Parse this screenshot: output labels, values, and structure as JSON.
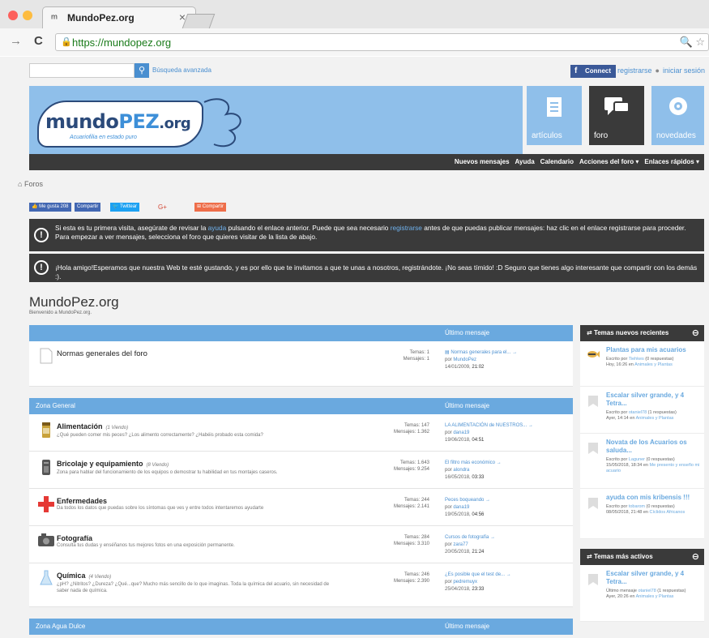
{
  "browser": {
    "tab_title": "MundoPez.org",
    "tab_close": "×",
    "url": "https://mundopez.org",
    "url_icons": "🔍 ☆"
  },
  "header": {
    "adv_search": "Búsqueda avanzada",
    "connect": "Connect",
    "register": "registrarse",
    "login": "iniciar sesión"
  },
  "logo": {
    "part1": "mundo",
    "part2": "PEZ",
    "part3": ".org",
    "tagline": "Acuariofilia en estado puro"
  },
  "nav_tiles": [
    {
      "label": "artículos",
      "icon": "document-icon"
    },
    {
      "label": "foro",
      "icon": "chat-icon"
    },
    {
      "label": "novedades",
      "icon": "eye-icon"
    }
  ],
  "nav_bar": [
    "Nuevos mensajes",
    "Ayuda",
    "Calendario",
    "Acciones del foro ▾",
    "Enlaces rápidos ▾"
  ],
  "breadcrumb": "Foros",
  "share": {
    "like": "Me gusta 208",
    "share_fb": "Compartir",
    "tweet": "Twittear",
    "gplus": "G+",
    "share": "Compartir"
  },
  "notices": {
    "n1_pre": "Si esta es tu primera visita, asegúrate de revisar la ",
    "n1_link1": "ayuda",
    "n1_mid": " pulsando el enlace anterior. Puede que sea necesario ",
    "n1_link2": "registrarse",
    "n1_post": " antes de que puedas publicar mensajes: haz clic en el enlace registrarse para proceder. Para empezar a ver mensajes, selecciona el foro que quieres visitar de la lista de abajo.",
    "n2": "¡Hola amigo!Esperamos que nuestra Web te esté gustando, y es por ello que te invitamos a que te unas a nosotros, registrándote. ¡No seas tímido! :D Seguro que tienes algo interesante que compartir con los demás :)."
  },
  "forum": {
    "title": "MundoPez.org",
    "subtitle": "Bienvenido a MundoPez.org.",
    "last_msg_header": "Último mensaje",
    "section_general": "Zona General",
    "section_agua": "Zona Agua Dulce",
    "rules": {
      "name": "Normas generales del foro",
      "stats1": "Temas: 1",
      "stats2": "Mensajes: 1",
      "last_title": "Normas generales para el...",
      "por": "por",
      "author": "MundoPez",
      "date": "14/01/2009,",
      "time": "21:02"
    },
    "rows": [
      {
        "name": "Alimentación",
        "view": "(1 Viendo)",
        "desc": "¿Qué pueden comer mis peces? ¿Los alimento correctamente? ¿Habéis probado esta comida?",
        "stats1": "Temas: 147",
        "stats2": "Mensajes: 1.362",
        "last_title": "LA ALIMENTACIÓN de NUESTROS...",
        "por": "por",
        "author": "dana19",
        "date": "19/06/2018,",
        "time": "04:51",
        "icon": "food-can-icon"
      },
      {
        "name": "Bricolaje y equipamiento",
        "view": "(8 Viendo)",
        "desc": "Zona para hablar del funcionamiento de los equipos o demostrar tu habilidad en tus montajes caseros.",
        "stats1": "Temas: 1.643",
        "stats2": "Mensajes: 9.254",
        "last_title": "El filtro más económico",
        "por": "por",
        "author": "alondra",
        "date": "16/05/2018,",
        "time": "03:33",
        "icon": "filter-icon"
      },
      {
        "name": "Enfermedades",
        "view": "",
        "desc": "Da todos los datos que puedas sobre los síntomas que ves y entre todos intentaremos ayudarte",
        "stats1": "Temas: 244",
        "stats2": "Mensajes: 2.141",
        "last_title": "Peces boqueando",
        "por": "por",
        "author": "dana19",
        "date": "19/05/2018,",
        "time": "04:56",
        "icon": "medical-cross-icon"
      },
      {
        "name": "Fotografía",
        "view": "",
        "desc": "Consulta tus dudas y enséñanos tus mejores fotos en una exposición permanente.",
        "stats1": "Temas: 284",
        "stats2": "Mensajes: 3.310",
        "last_title": "Cursos de fotografía",
        "por": "por",
        "author": "zara77",
        "date": "20/05/2018,",
        "time": "21:24",
        "icon": "camera-icon"
      },
      {
        "name": "Química",
        "view": "(4 Viendo)",
        "desc": "¿pH? ¿Nitritos? ¿Dureza? ¿Qué...que? Mucho más sencillo de lo que imaginas. Toda la química del acuario, sin necesidad de saber nada de química.",
        "stats1": "Temas: 246",
        "stats2": "Mensajes: 2.390",
        "last_title": "¿Es posible que el test de...",
        "por": "por",
        "author": "pedremuyx",
        "date": "25/04/2018,",
        "time": "23:33",
        "icon": "flask-icon"
      }
    ]
  },
  "sidebar": {
    "recent_title": "Temas nuevos recientes",
    "active_title": "Temas más activos",
    "collapse": "⊖",
    "recent": [
      {
        "title": "Plantas para mis acuarios",
        "meta1": "Escrito por ",
        "author": "Tiehkes",
        "meta2": " (0 respuestas)",
        "meta3": "Hoy, 16:26 en ",
        "cat": "Animales y Plantas"
      },
      {
        "title": "Escalar silver grande, y 4 Tetra...",
        "meta1": "Escrito por ",
        "author": "otaniel78",
        "meta2": " (1 respuestas)",
        "meta3": "Ayer, 14:14 en ",
        "cat": "Animales y Plantas"
      },
      {
        "title": "Novata de los Acuarios os saluda...",
        "meta1": "Escrito por ",
        "author": "Laguner",
        "meta2": " (0 respuestas)",
        "meta3": "15/05/2018, 18:34 en ",
        "cat": "Me presento y enseño mi acuario"
      },
      {
        "title": "ayuda con mis kribensis !!!",
        "meta1": "Escrito por ",
        "author": "tobarom",
        "meta2": " (0 respuestas)",
        "meta3": "08/05/2018, 21:48 en ",
        "cat": "Cíclidos Africanos"
      }
    ],
    "active": [
      {
        "title": "Escalar silver grande, y 4 Tetra...",
        "meta1": "Último mensaje ",
        "author": "otaniel78",
        "meta2": " (1 respuestas)",
        "meta3": "Ayer, 20:26 en ",
        "cat": "Animales y Plantas"
      }
    ]
  }
}
